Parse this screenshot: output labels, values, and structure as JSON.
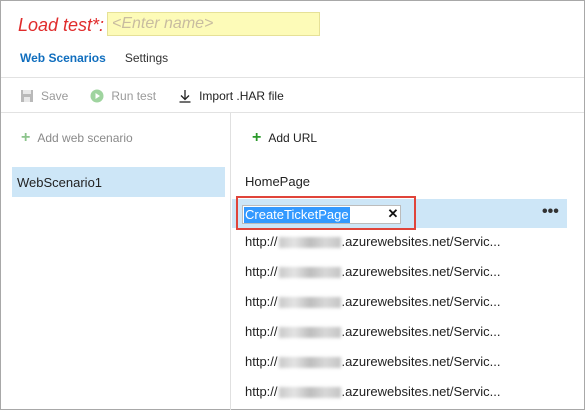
{
  "header": {
    "title": "Load test*:",
    "name_placeholder": "<Enter name>"
  },
  "tabs": [
    {
      "label": "Web Scenarios",
      "active": true
    },
    {
      "label": "Settings",
      "active": false
    }
  ],
  "toolbar": {
    "save_label": "Save",
    "run_label": "Run test",
    "import_label": "Import .HAR file"
  },
  "left_pane": {
    "add_label": "Add web scenario",
    "scenarios": [
      "WebScenario1"
    ]
  },
  "right_pane": {
    "add_label": "Add URL",
    "items": [
      {
        "label": "HomePage"
      }
    ],
    "editing_value": "CreateTicketPage",
    "clear_glyph": "✕",
    "more_glyph": "•••",
    "url_prefix": "http://",
    "url_suffix": ".azurewebsites.net/Servic...",
    "urls": [
      "http://",
      "http://",
      "http://",
      "http://",
      "http://",
      "http://"
    ]
  },
  "colors": {
    "accent": "#106ebe",
    "title_red": "#e02c2c",
    "selection": "#cde6f7",
    "highlight_box": "#e0443a",
    "name_field_bg": "#fdfbb8"
  }
}
